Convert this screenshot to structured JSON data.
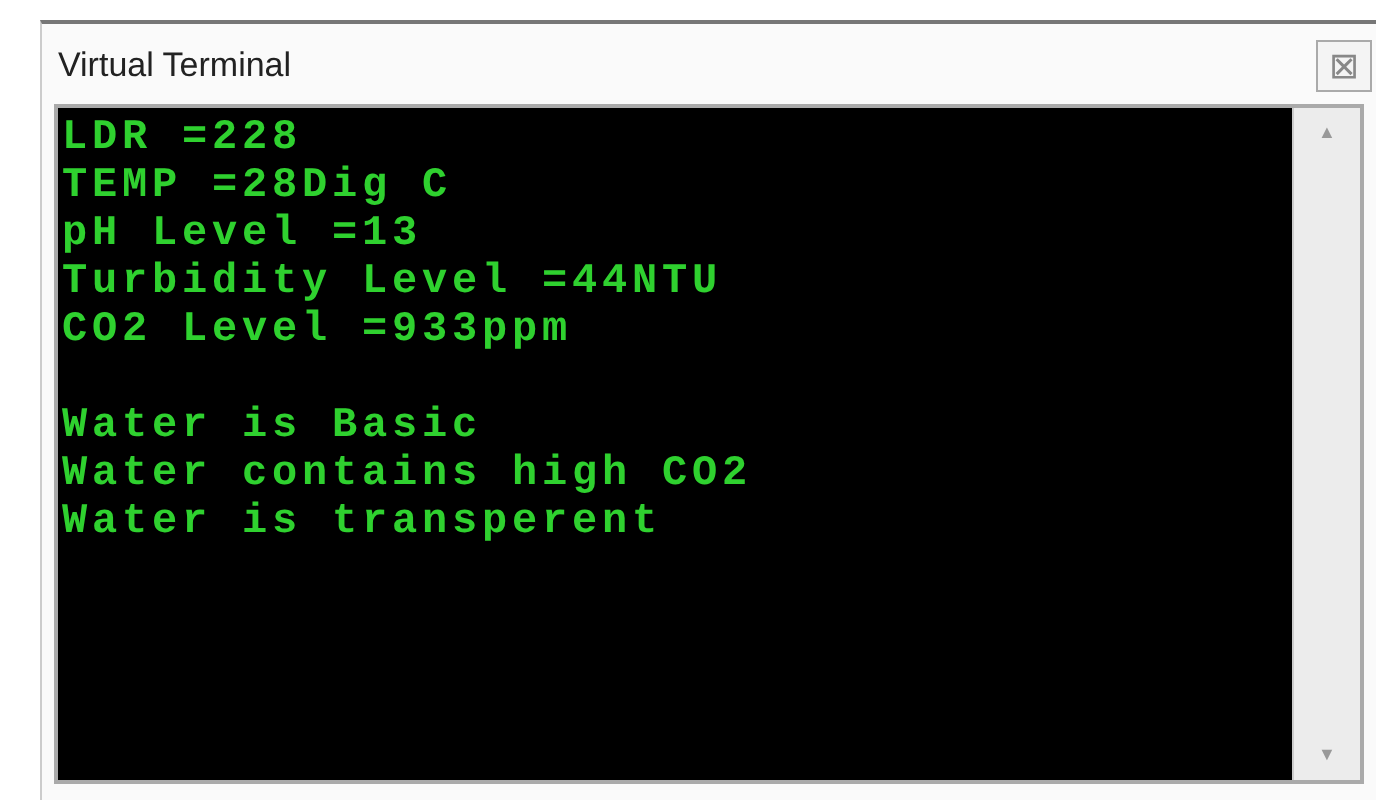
{
  "window": {
    "title": "Virtual Terminal",
    "close": "⊠"
  },
  "terminal": {
    "readings": [
      "LDR =228",
      "TEMP =28Dig C",
      "pH Level =13",
      "Turbidity Level =44NTU",
      "CO2 Level =933ppm"
    ],
    "messages": [
      "Water is Basic",
      "Water contains high CO2",
      "Water is transperent"
    ]
  },
  "scrollbar": {
    "up": "▲",
    "down": "▼"
  }
}
